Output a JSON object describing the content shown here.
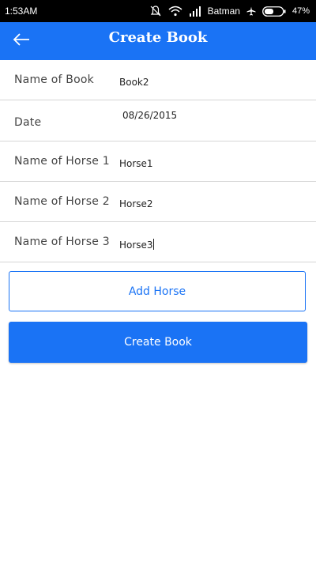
{
  "status_bar": {
    "time": "1:53AM",
    "carrier": "Batman",
    "battery": "47%",
    "icons": [
      "notifications-off-icon",
      "wifi-icon",
      "signal-icon",
      "airplane-icon",
      "battery-icon"
    ]
  },
  "app_bar": {
    "title": "Create Book",
    "back_icon": "arrow-left-icon",
    "color": "#1a73f5"
  },
  "form": {
    "rows": [
      {
        "label": "Name of Book",
        "value": "Book2"
      },
      {
        "label": "Date",
        "value": "08/26/2015"
      },
      {
        "label": "Name of Horse 1",
        "value": "Horse1"
      },
      {
        "label": "Name of Horse 2",
        "value": "Horse2"
      },
      {
        "label": "Name of Horse 3",
        "value": "Horse3"
      }
    ]
  },
  "buttons": {
    "add_horse": "Add Horse",
    "create_book": "Create Book"
  }
}
